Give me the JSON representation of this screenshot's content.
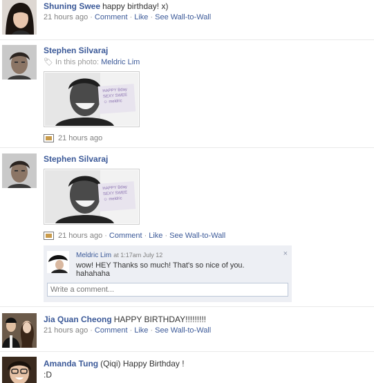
{
  "stories": [
    {
      "name": "Shuning Swee",
      "message": "happy birthday! x)",
      "time": "21 hours ago",
      "actions": [
        "Comment",
        "Like",
        "See Wall-to-Wall"
      ],
      "avatar_icon": "female-profile-photo"
    },
    {
      "name": "Stephen Silvaraj",
      "tag_prefix": "In this photo:",
      "tag_person": "Meldric Lim",
      "time": "21 hours ago",
      "photo_sign": [
        "HAPPY Bday",
        "SEXY SWEE",
        "☺ meldric"
      ],
      "avatar_icon": "male-profile-photo"
    },
    {
      "name": "Stephen Silvaraj",
      "time": "21 hours ago",
      "actions": [
        "Comment",
        "Like",
        "See Wall-to-Wall"
      ],
      "photo_sign": [
        "HAPPY Bday",
        "SEXY SWEE",
        "☺ meldric"
      ],
      "comment": {
        "name": "Meldric Lim",
        "time": "at 1:17am July 12",
        "text": "wow! HEY Thanks so much! That's so nice of you. hahahaha",
        "close_glyph": "×"
      },
      "write_placeholder": "Write a comment..."
    },
    {
      "name": "Jia Quan Cheong",
      "message": "HAPPY BIRTHDAY!!!!!!!!!",
      "time": "21 hours ago",
      "actions": [
        "Comment",
        "Like",
        "See Wall-to-Wall"
      ]
    },
    {
      "name": "Amanda Tung",
      "message": "(Qiqi) Happy Birthday !",
      "message2": ":D"
    }
  ],
  "colors": {
    "link": "#3b5998",
    "comment_bg": "#edeff4",
    "meta": "#808080"
  }
}
